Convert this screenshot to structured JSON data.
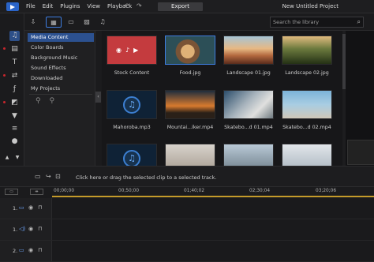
{
  "titlebar": {
    "menu": [
      "File",
      "Edit",
      "Plugins",
      "View",
      "Playback"
    ],
    "undo_icon": "undo-icon",
    "redo_icon": "redo-icon",
    "export_label": "Export",
    "project_title": "New Untitled Project"
  },
  "search": {
    "placeholder": "Search the library"
  },
  "categories": [
    {
      "label": "Media Content",
      "selected": true
    },
    {
      "label": "Color Boards"
    },
    {
      "label": "Background Music"
    },
    {
      "label": "Sound Effects"
    },
    {
      "label": "Downloaded"
    },
    {
      "label": "My Projects"
    }
  ],
  "library": {
    "items": [
      {
        "label": "Stock Content"
      },
      {
        "label": "Food.jpg"
      },
      {
        "label": "Landscape 01.jpg"
      },
      {
        "label": "Landscape 02.jpg"
      },
      {
        "label": "Mahoroba.mp3"
      },
      {
        "label": "Mountai...iker.mp4"
      },
      {
        "label": "Skatebo...d 01.mp4"
      },
      {
        "label": "Skatebo...d 02.mp4"
      }
    ]
  },
  "timeline": {
    "hint": "Click here or drag the selected clip to a selected track.",
    "ruler_ticks": [
      "00;00;00",
      "00;50;00",
      "01;40;02",
      "02;30;04",
      "03;20;06"
    ],
    "tracks": [
      {
        "number": "1."
      },
      {
        "number": "1."
      },
      {
        "number": "2."
      }
    ]
  },
  "colors": {
    "accent": "#3e7de0",
    "ruler": "#c49a2a",
    "stock_tile": "#c43b3e",
    "record_dot": "#c7262c"
  }
}
